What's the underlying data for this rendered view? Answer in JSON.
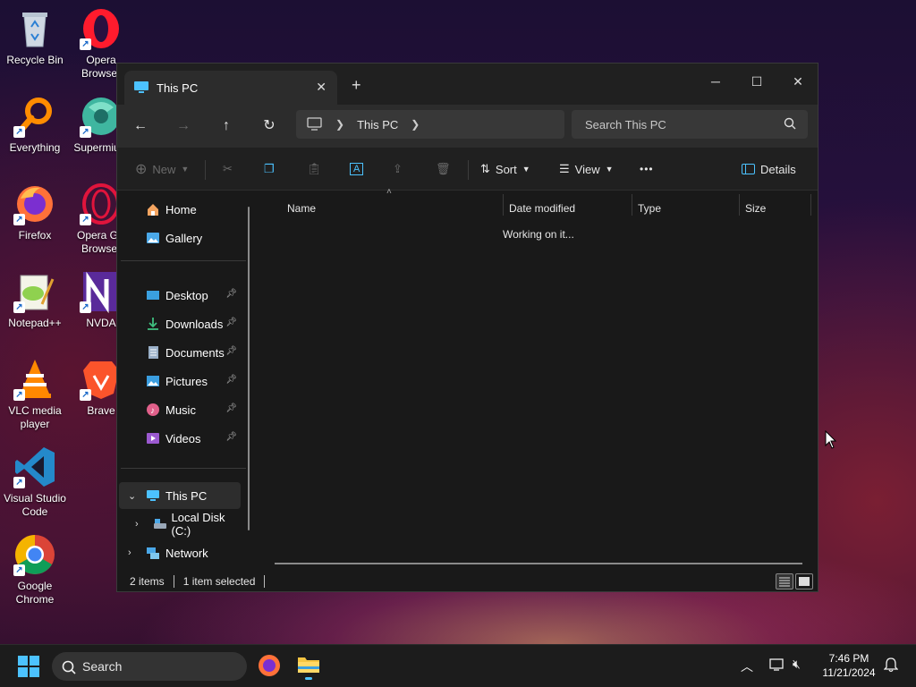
{
  "desktop": {
    "icons": [
      {
        "label": "Recycle Bin"
      },
      {
        "label": "Everything"
      },
      {
        "label": "Firefox"
      },
      {
        "label": "Notepad++"
      },
      {
        "label": "VLC media player"
      },
      {
        "label": "Visual Studio Code"
      },
      {
        "label": "Google Chrome"
      },
      {
        "label": "Opera Browser"
      },
      {
        "label": "Supermium"
      },
      {
        "label": "Opera GX Browser"
      },
      {
        "label": "NVDA"
      },
      {
        "label": "Brave"
      }
    ]
  },
  "window": {
    "tab_title": "This PC",
    "new_tab_symbol": "+",
    "controls": {
      "minimize": "─",
      "maximize": "☐",
      "close": "✕"
    }
  },
  "address": {
    "path": "This PC",
    "search_placeholder": "Search This PC"
  },
  "toolbar": {
    "new_label": "New",
    "sort_label": "Sort",
    "view_label": "View",
    "more_label": "•••",
    "details_label": "Details"
  },
  "sidebar": {
    "items": [
      {
        "label": "Home"
      },
      {
        "label": "Gallery"
      },
      {
        "label": "Desktop"
      },
      {
        "label": "Downloads"
      },
      {
        "label": "Documents"
      },
      {
        "label": "Pictures"
      },
      {
        "label": "Music"
      },
      {
        "label": "Videos"
      },
      {
        "label": "This PC"
      },
      {
        "label": "Local Disk (C:)"
      },
      {
        "label": "Network"
      }
    ]
  },
  "columns": {
    "name": "Name",
    "date_modified": "Date modified",
    "type": "Type",
    "size": "Size"
  },
  "content": {
    "status_message": "Working on it..."
  },
  "statusbar": {
    "item_count": "2 items",
    "selection": "1 item selected"
  },
  "taskbar": {
    "search_label": "Search",
    "time": "7:46 PM",
    "date": "11/21/2024"
  },
  "colors": {
    "window_bg": "#191919",
    "accent": "#4cc2ff",
    "folder_yellow": "#f5c542"
  }
}
